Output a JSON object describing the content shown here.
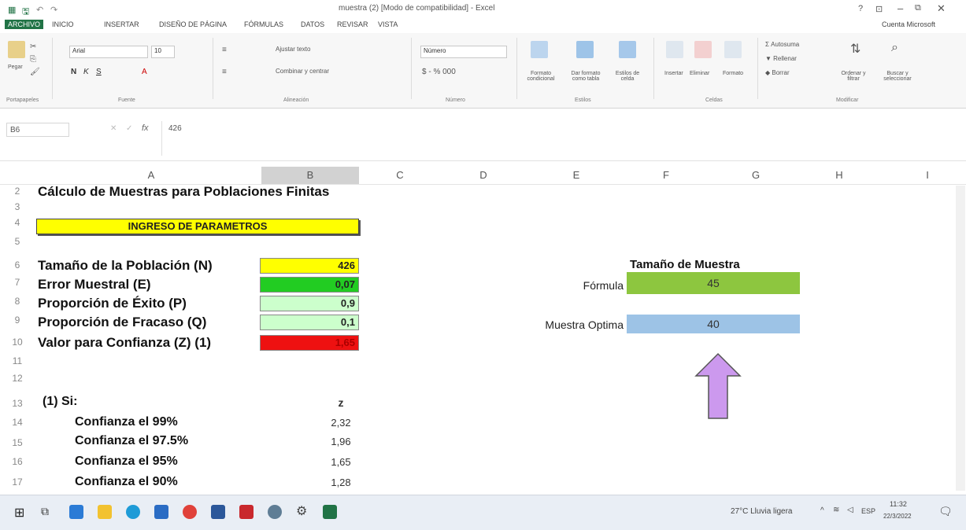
{
  "window": {
    "title": "muestra (2) [Modo de compatibilidad] - Excel",
    "account": "Cuenta Microsoft"
  },
  "ribbon": {
    "tabs": [
      "ARCHIVO",
      "INICIO",
      "INSERTAR",
      "DISEÑO DE PÁGINA",
      "FÓRMULAS",
      "DATOS",
      "REVISAR",
      "VISTA"
    ],
    "paste": "Pegar",
    "font_name": "Arial",
    "font_size": "10",
    "wrap_text": "Ajustar texto",
    "merge_center": "Combinar y centrar",
    "number_format": "Número",
    "cond_format": "Formato condicional",
    "table_format": "Dar formato como tabla",
    "cell_styles": "Estilos de celda",
    "insert": "Insertar",
    "delete": "Eliminar",
    "format": "Formato",
    "autosum": "Autosuma",
    "fill": "Rellenar",
    "clear": "Borrar",
    "sort_filter": "Ordenar y filtrar",
    "find_select": "Buscar y seleccionar",
    "groups": [
      "Portapapeles",
      "Fuente",
      "Alineación",
      "Número",
      "Estilos",
      "Celdas",
      "Modificar"
    ]
  },
  "formula_bar": {
    "name_box": "B6",
    "value": "426"
  },
  "columns": [
    "A",
    "B",
    "C",
    "D",
    "E",
    "F",
    "G",
    "H",
    "I"
  ],
  "rows": [
    "2",
    "3",
    "4",
    "5",
    "6",
    "7",
    "8",
    "9",
    "10",
    "11",
    "12",
    "13",
    "14",
    "15",
    "16",
    "17"
  ],
  "sheet": {
    "title": "Cálculo de Muestras para Poblaciones Finitas",
    "header_box": "INGRESO DE PARAMETROS",
    "params": [
      {
        "label": "Tamaño de la Población (N)",
        "value": "426",
        "color": "#ffff00"
      },
      {
        "label": "Error Muestral (E)",
        "value": "0,07",
        "color": "#22cc22"
      },
      {
        "label": "Proporción de Éxito (P)",
        "value": "0,9",
        "color": "#ccffcc"
      },
      {
        "label": "Proporción de Fracaso (Q)",
        "value": "0,1",
        "color": "#ccffcc"
      },
      {
        "label": "Valor para Confianza (Z) (1)",
        "value": "1,65",
        "color": "#ee1111"
      }
    ],
    "note_label": "(1)  Si:",
    "z_header": "z",
    "confidence": [
      {
        "label": "Confianza el 99%",
        "z": "2,32"
      },
      {
        "label": "Confianza el 97.5%",
        "z": "1,96"
      },
      {
        "label": "Confianza el 95%",
        "z": "1,65"
      },
      {
        "label": "Confianza el 90%",
        "z": "1,28"
      }
    ],
    "result_title": "Tamaño de Muestra",
    "formula_label": "Fórmula",
    "formula_value": "45",
    "optimal_label": "Muestra Optima",
    "optimal_value": "40"
  },
  "taskbar": {
    "weather": "27°C  Lluvia ligera",
    "lang": "ESP",
    "time": "11:32",
    "date": "22/3/2022"
  },
  "colors": {
    "excel_green": "#217346",
    "formula_fill": "#8dc63f",
    "optimal_fill": "#9dc3e6",
    "arrow_fill": "#cc99ee"
  }
}
